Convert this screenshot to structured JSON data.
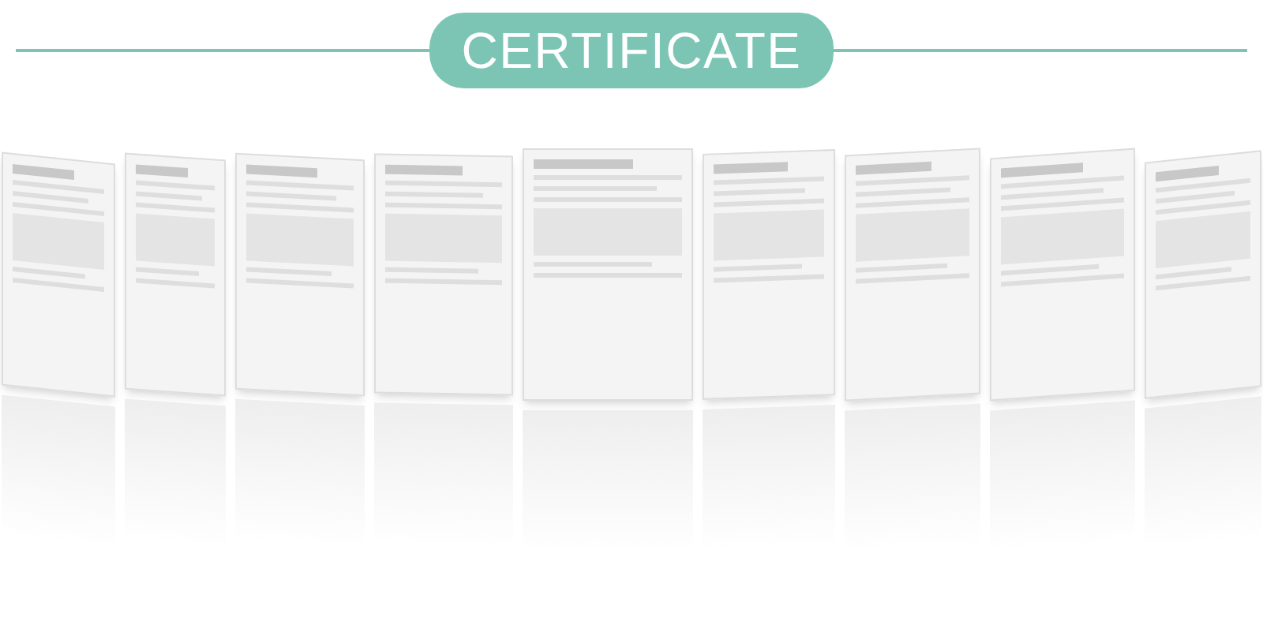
{
  "header": {
    "title": "CERTIFICATE"
  }
}
